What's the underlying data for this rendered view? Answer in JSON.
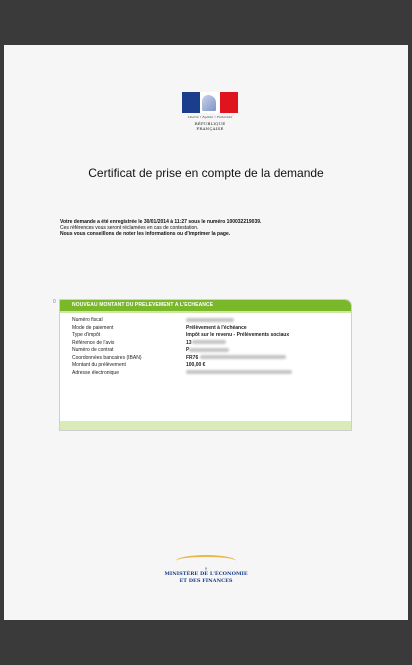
{
  "header": {
    "motto": "Liberté • Égalité • Fraternité",
    "republic": "RÉPUBLIQUE FRANÇAISE"
  },
  "title": "Certificat de prise en compte de la demande",
  "intro": {
    "line1": "Votre demande a été enregistrée le 30/01/2014 à 11:27 sous le numéro 100032219039.",
    "line2": "Ces références vous seront réclamées en cas de contestation.",
    "line3": "Nous vous conseillons de noter les informations ou d'imprimer la page."
  },
  "card": {
    "marker": "0",
    "heading": "NOUVEAU MONTANT DU PRELEVEMENT A L'ECHEANCE",
    "rows": [
      {
        "label": "Numéro fiscal",
        "value": ""
      },
      {
        "label": "Mode de paiement",
        "value": "Prélèvement à l'échéance"
      },
      {
        "label": "Type d'impôt",
        "value": "Impôt sur le revenu - Prélèvements sociaux"
      },
      {
        "label": "Référence de l'avis",
        "value": "13"
      },
      {
        "label": "Numéro de contrat",
        "value": "P"
      },
      {
        "label": "Coordonnées bancaires (IBAN)",
        "value": "FR76"
      },
      {
        "label": "Montant du prélèvement",
        "value": "100,00 €"
      },
      {
        "label": "Adresse électronique",
        "value": ""
      }
    ]
  },
  "footer": {
    "ministry_line1": "MINISTÈRE DE L'ÉCONOMIE",
    "ministry_line2": "ET DES FINANCES"
  }
}
